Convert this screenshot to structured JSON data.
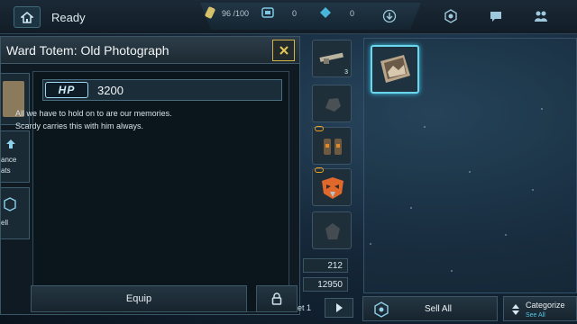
{
  "topbar": {
    "status": "Ready",
    "energy": "96 /100",
    "currency_a": "0",
    "currency_b": "0"
  },
  "dialog": {
    "title": "Ward Totem: Old Photograph",
    "hp_label": "HP",
    "hp_value": "3200",
    "description_line1": "All we have to hold on to are our memories.",
    "description_line2": "Scardy carries this with him always.",
    "side_tabs": [
      "ance",
      "ats",
      "ell"
    ],
    "equip_label": "Equip"
  },
  "inventory_column": {
    "slot_counts": [
      "3"
    ],
    "stat_1": "212",
    "stat_2": "12950"
  },
  "bottom_bar": {
    "page_label": "et 1",
    "sell_all_label": "Sell All",
    "categorize_label": "Categorize",
    "categorize_sub": "See All"
  },
  "colors": {
    "accent_cyan": "#6ad7ee",
    "close_gold": "#d1b34a",
    "panel_dark": "#0f1a23"
  },
  "icons": [
    "home-icon",
    "energy-icon",
    "crate-icon",
    "crystal-icon",
    "download-icon",
    "hex-icon",
    "chat-icon",
    "group-icon",
    "close-icon",
    "lock-icon",
    "arrow-right-icon",
    "sell-icon",
    "sort-icon"
  ]
}
